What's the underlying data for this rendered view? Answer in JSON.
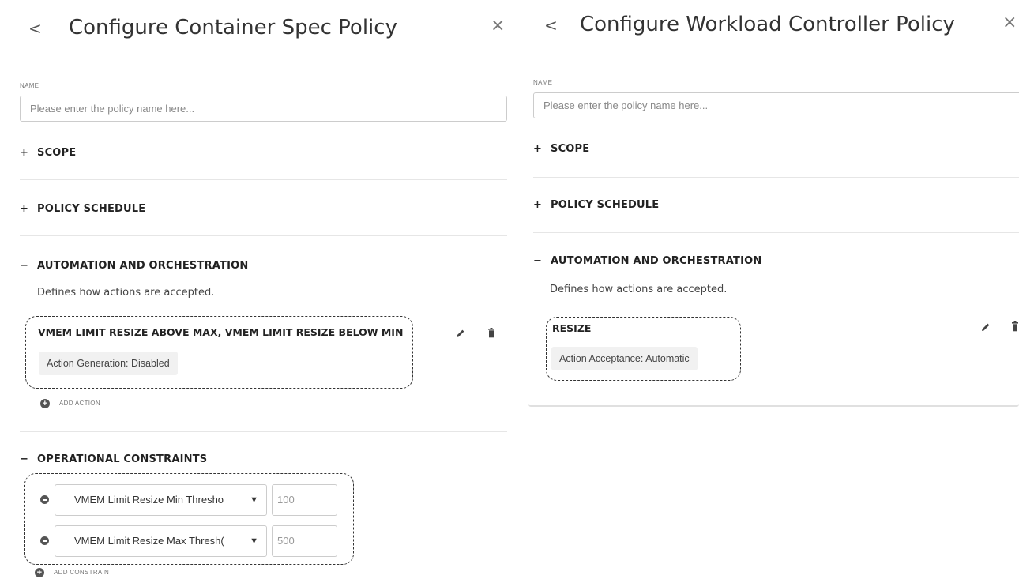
{
  "left_panel": {
    "title": "Configure Container Spec Policy",
    "back_icon": "<",
    "close_icon": "×",
    "name_label": "NAME",
    "name_placeholder": "Please enter the policy name here...",
    "sections": {
      "scope": {
        "symbol": "+",
        "label": "SCOPE"
      },
      "schedule": {
        "symbol": "+",
        "label": "POLICY SCHEDULE"
      },
      "automation": {
        "symbol": "−",
        "label": "AUTOMATION AND ORCHESTRATION"
      },
      "constraints": {
        "symbol": "−",
        "label": "OPERATIONAL CONSTRAINTS"
      }
    },
    "automation_desc": "Defines how actions are accepted.",
    "action": {
      "title": "VMEM LIMIT RESIZE ABOVE MAX, VMEM LIMIT RESIZE BELOW MIN",
      "chip": "Action Generation: Disabled"
    },
    "add_action": "ADD ACTION",
    "constraints": [
      {
        "select": "VMEM Limit Resize Min Thresho",
        "value": "100"
      },
      {
        "select": "VMEM Limit Resize Max Thresh(",
        "value": "500"
      }
    ],
    "add_constraint": "ADD CONSTRAINT"
  },
  "right_panel": {
    "title": "Configure Workload Controller Policy",
    "back_icon": "<",
    "close_icon": "×",
    "name_label": "NAME",
    "name_placeholder": "Please enter the policy name here...",
    "sections": {
      "scope": {
        "symbol": "+",
        "label": "SCOPE"
      },
      "schedule": {
        "symbol": "+",
        "label": "POLICY SCHEDULE"
      },
      "automation": {
        "symbol": "−",
        "label": "AUTOMATION AND ORCHESTRATION"
      }
    },
    "automation_desc": "Defines how actions are accepted.",
    "action": {
      "title": "RESIZE",
      "chip": "Action Acceptance: Automatic"
    }
  },
  "icons": {
    "edit": "pencil-icon",
    "delete": "trash-icon",
    "add": "plus-circle-icon",
    "remove": "minus-circle-icon",
    "dropdown": "chevron-down-icon"
  }
}
